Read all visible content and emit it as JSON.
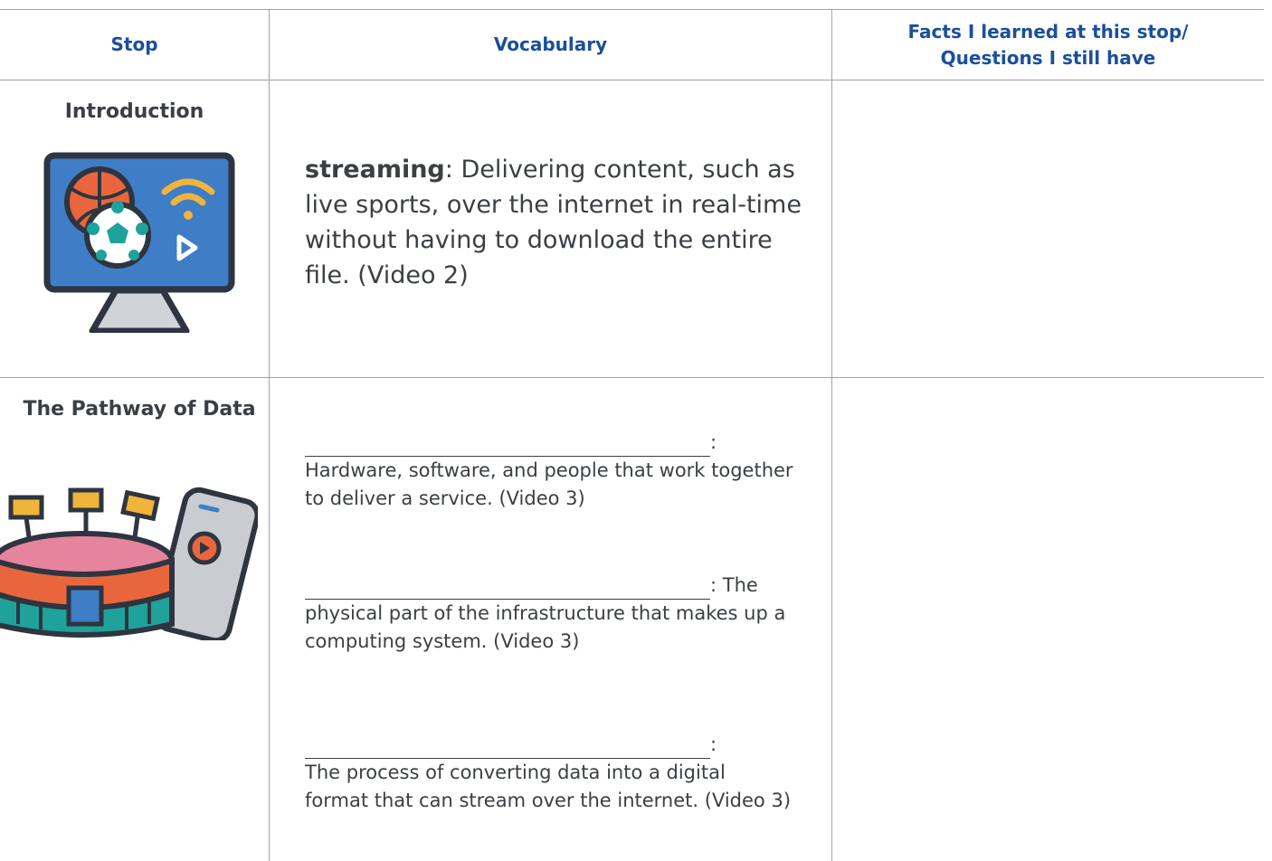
{
  "table": {
    "headers": {
      "stop": "Stop",
      "vocabulary": "Vocabulary",
      "facts_line1": "Facts I learned at this stop/",
      "facts_line2": "Questions I still have"
    },
    "rows": [
      {
        "stop": "Introduction",
        "icon": "streaming-monitor-icon",
        "term": "streaming",
        "separator": ":",
        "definition": " Delivering content, such as live sports, over the internet in real-time without having to download the entire file. (Video 2)"
      },
      {
        "stop": "The Pathway of Data",
        "icon": "stadium-phone-icon",
        "terms": [
          {
            "suffix": ":",
            "definition": "Hardware, software, and people that work together to deliver a service. (Video 3)"
          },
          {
            "suffix": ": The",
            "definition": "physical part of the infrastructure that makes up a computing system. (Video 3)"
          },
          {
            "suffix": ":",
            "definition": "The process of converting data into a digital format that can stream over the internet. (Video 3)"
          }
        ]
      }
    ]
  },
  "colors": {
    "header_text": "#1a4f9c",
    "body_text": "#3b3f44",
    "rule": "#9da3a8"
  }
}
